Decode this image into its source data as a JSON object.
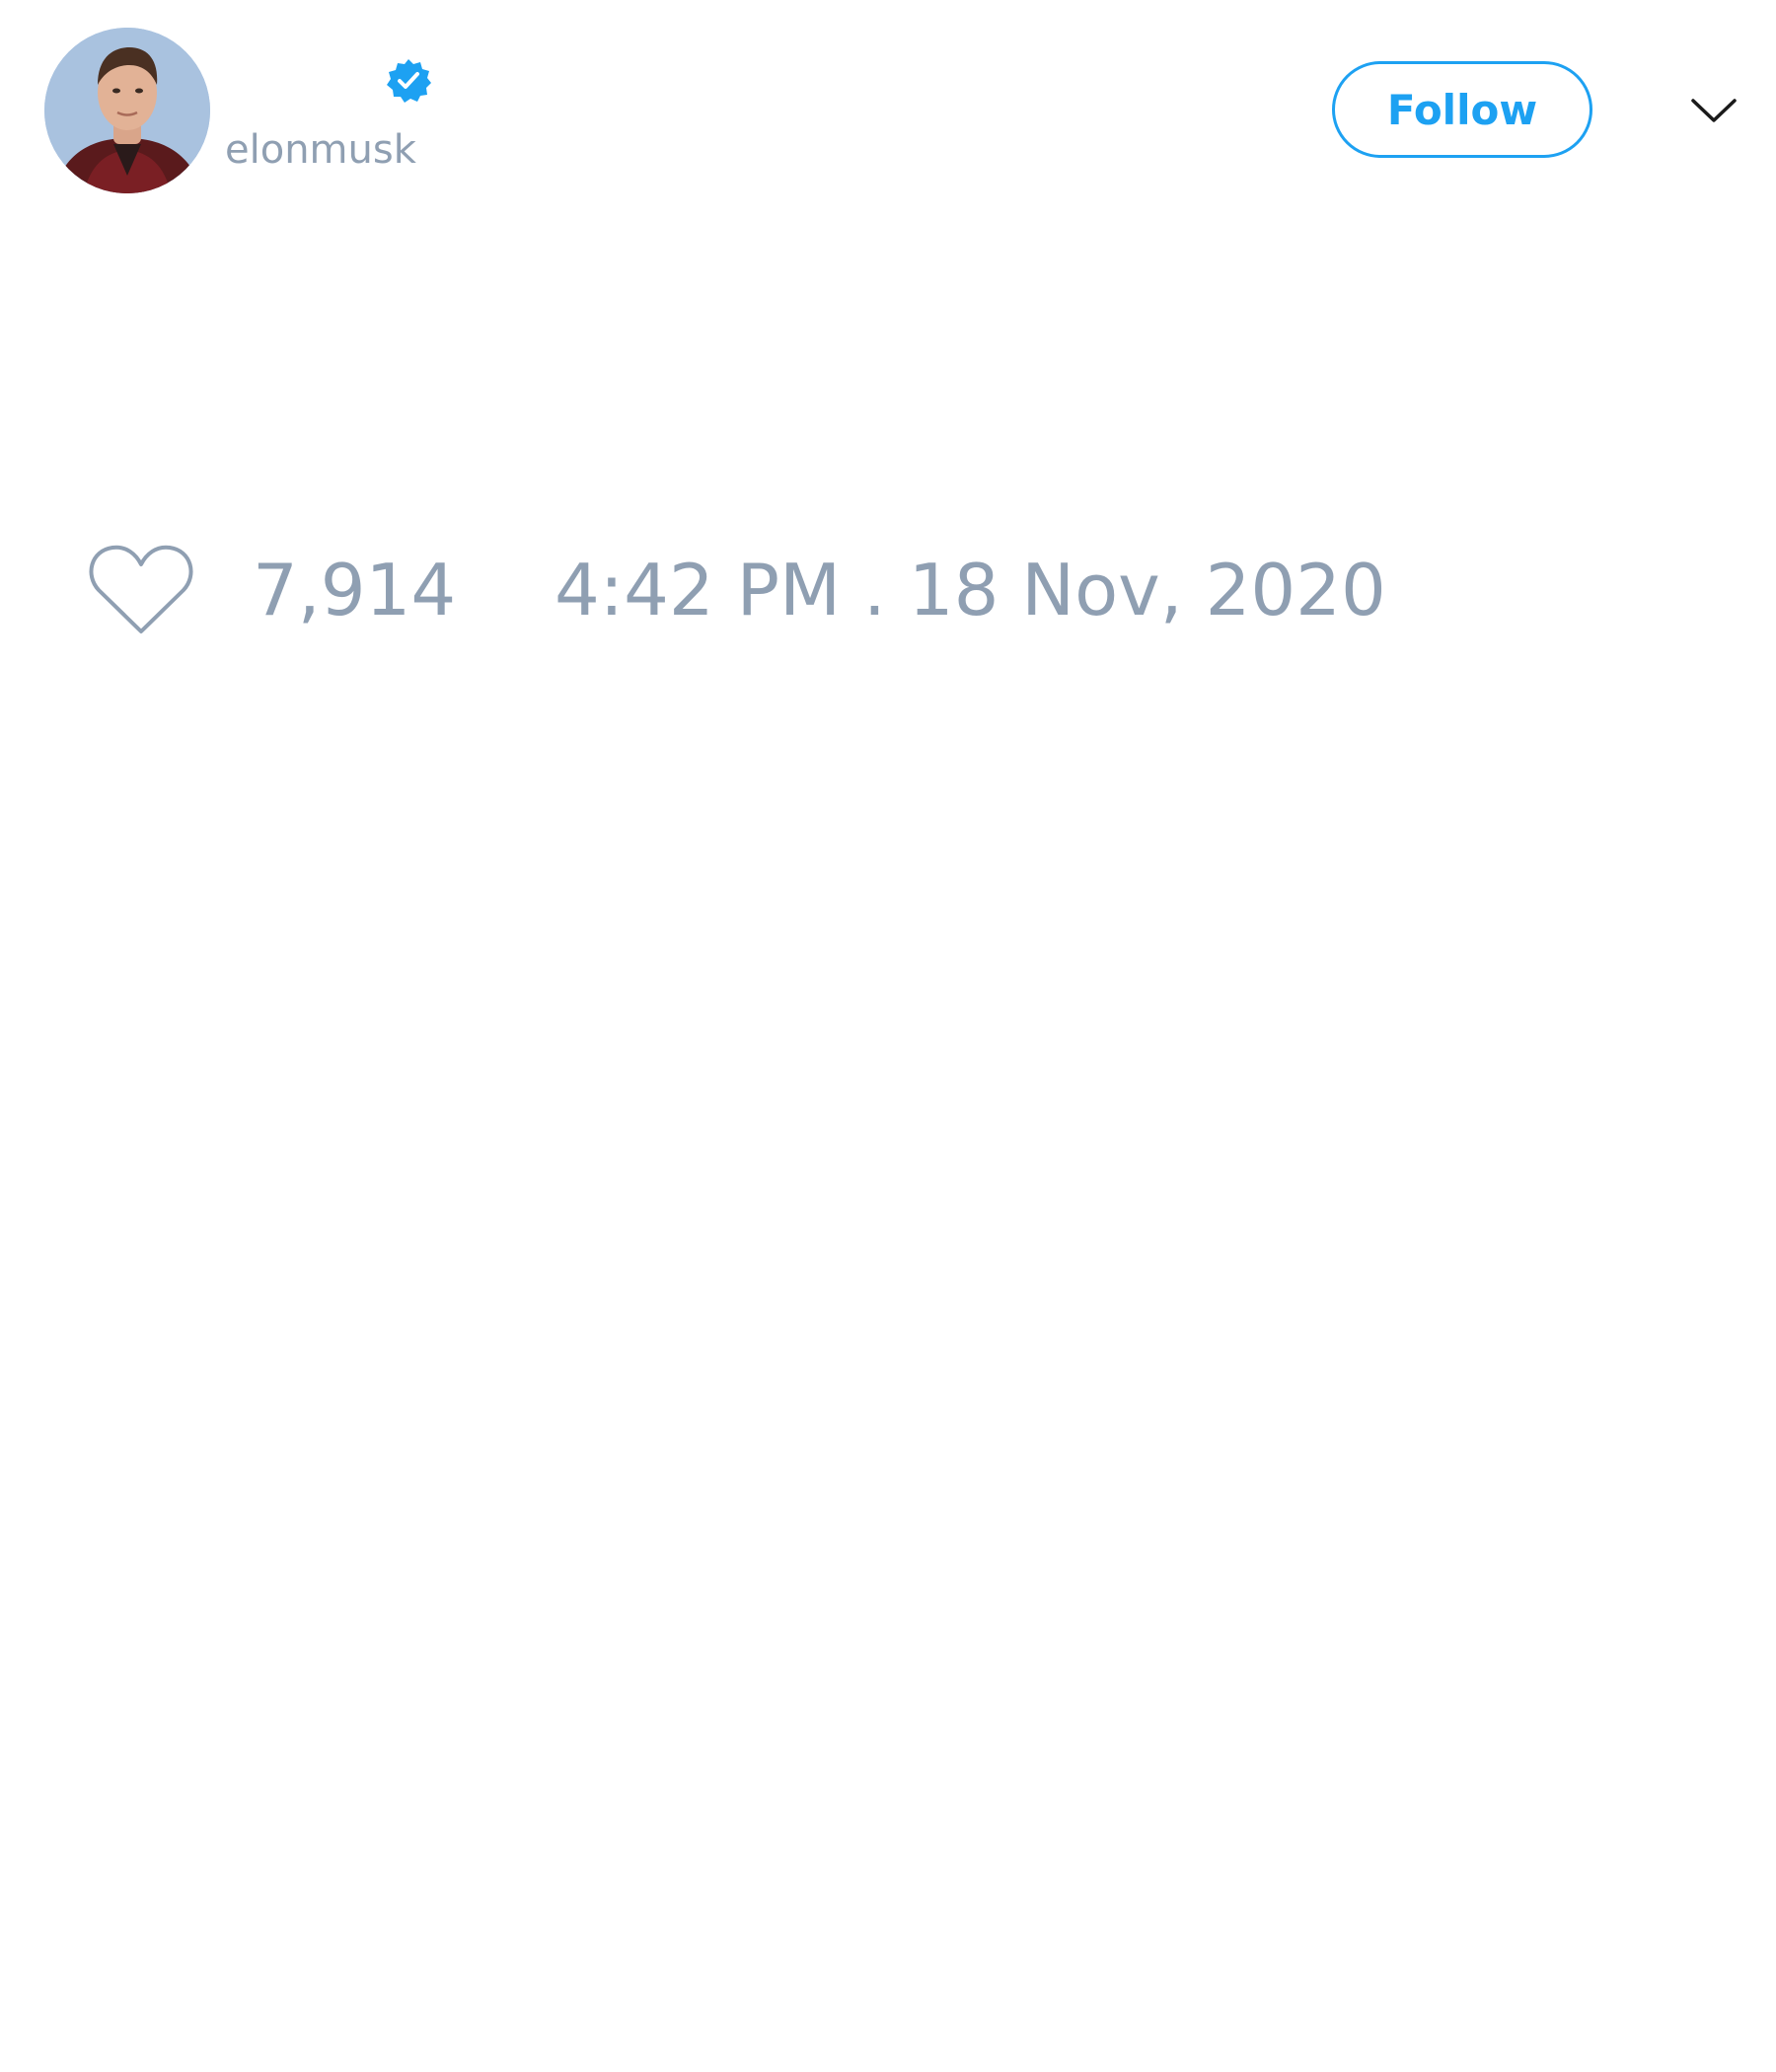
{
  "tweet": {
    "author": {
      "handle": "elonmusk",
      "verified": true,
      "avatar_icon": "profile-photo"
    },
    "follow_label": "Follow",
    "more_icon": "chevron-down-icon",
    "like_icon": "heart-outline-icon",
    "like_count": "7,914",
    "timestamp": "4:42 PM . 18 Nov, 2020"
  },
  "colors": {
    "accent": "#1da1f2",
    "muted_text": "#8f9fb2",
    "background": "#ffffff"
  }
}
